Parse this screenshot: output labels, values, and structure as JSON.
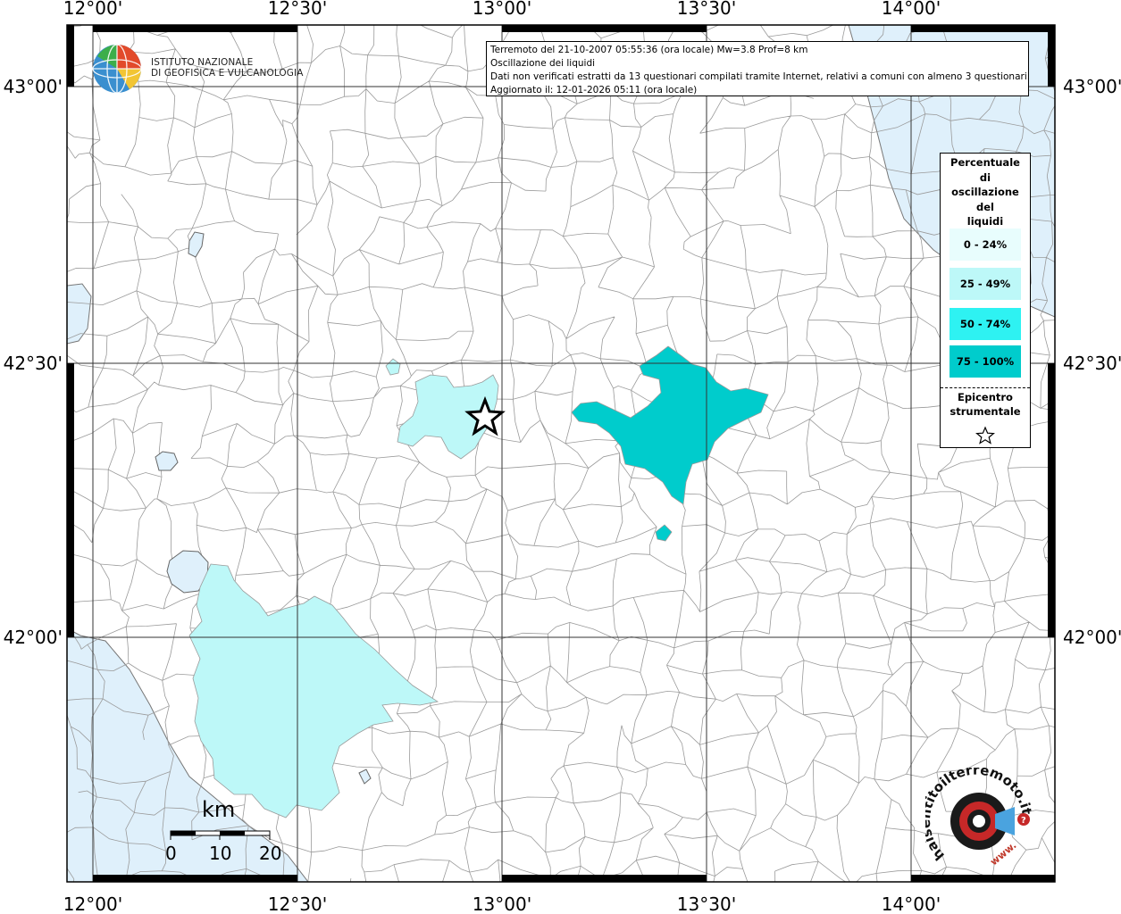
{
  "map": {
    "lon_labels": [
      "12°00'",
      "12°30'",
      "13°00'",
      "13°30'",
      "14°00'"
    ],
    "lat_labels": [
      "43°00'",
      "42°30'",
      "42°00'"
    ],
    "colors": {
      "sea": "#dff0fb",
      "land": "#ffffff",
      "boundary": "#9a9a9a",
      "class_0_24": "#e8fdfd",
      "class_25_49": "#bdf8f8",
      "class_50_74": "#2ef2f2",
      "class_75_100": "#00cccc"
    }
  },
  "info": {
    "line1": "Terremoto del 21-10-2007 05:55:36 (ora locale) Mw=3.8 Prof=8 km",
    "line2": "Oscillazione dei liquidi",
    "line3": "Dati non verificati estratti da 13 questionari compilati tramite Internet, relativi a comuni con almeno 3 questionari.",
    "line4": "Aggiornato il: 12-01-2026 05:11 (ora locale)"
  },
  "ingv": {
    "line1": "ISTITUTO NAZIONALE",
    "line2": "DI GEOFISICA E VULCANOLOGIA"
  },
  "legend": {
    "title_lines": [
      "Percentuale",
      "di",
      "oscillazione",
      "del",
      "liquidi"
    ],
    "classes": [
      "0 - 24%",
      "25 - 49%",
      "50 - 74%",
      "75 - 100%"
    ],
    "epicenter_lines": [
      "Epicentro",
      "strumentale"
    ]
  },
  "scalebar": {
    "unit": "km",
    "labels": [
      "0",
      "10",
      "20"
    ]
  },
  "logo": {
    "text": "haisentitoilterremoto.it",
    "text_alt": "www."
  }
}
